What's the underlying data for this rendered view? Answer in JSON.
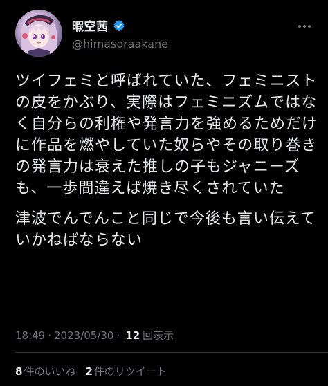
{
  "colors": {
    "background": "#000000",
    "text_primary": "#e7e9ea",
    "text_secondary": "#71767b",
    "verified": "#1d9bf0",
    "divider": "#2f3336"
  },
  "author": {
    "display_name": "暇空茜",
    "handle": "@himasoraakane",
    "avatar_icon": "avatar-anime-girl",
    "verified_icon": "verified-badge-icon"
  },
  "tweet": {
    "paragraphs": [
      "ツイフェミと呼ばれていた、フェミニストの皮をかぶり、実際はフェミニズムではなく自分らの利権や発言力を強めるためだけに作品を燃やしていた奴らやその取り巻きの発言力は衰えた推しの子もジャニーズも、一歩間違えば焼き尽くされていた",
      "津波でんでんこと同じで今後も言い伝えていかねばならない"
    ]
  },
  "meta": {
    "time": "18:49",
    "separator": "·",
    "date": "2023/05/30",
    "separator2": "·",
    "views_count": "12",
    "views_label": "回表示"
  },
  "stats": {
    "likes_count": "8",
    "likes_label": "件のいいね",
    "retweets_count": "2",
    "retweets_label": "件のリツイート"
  },
  "header": {
    "more_icon": "more-options-icon"
  }
}
